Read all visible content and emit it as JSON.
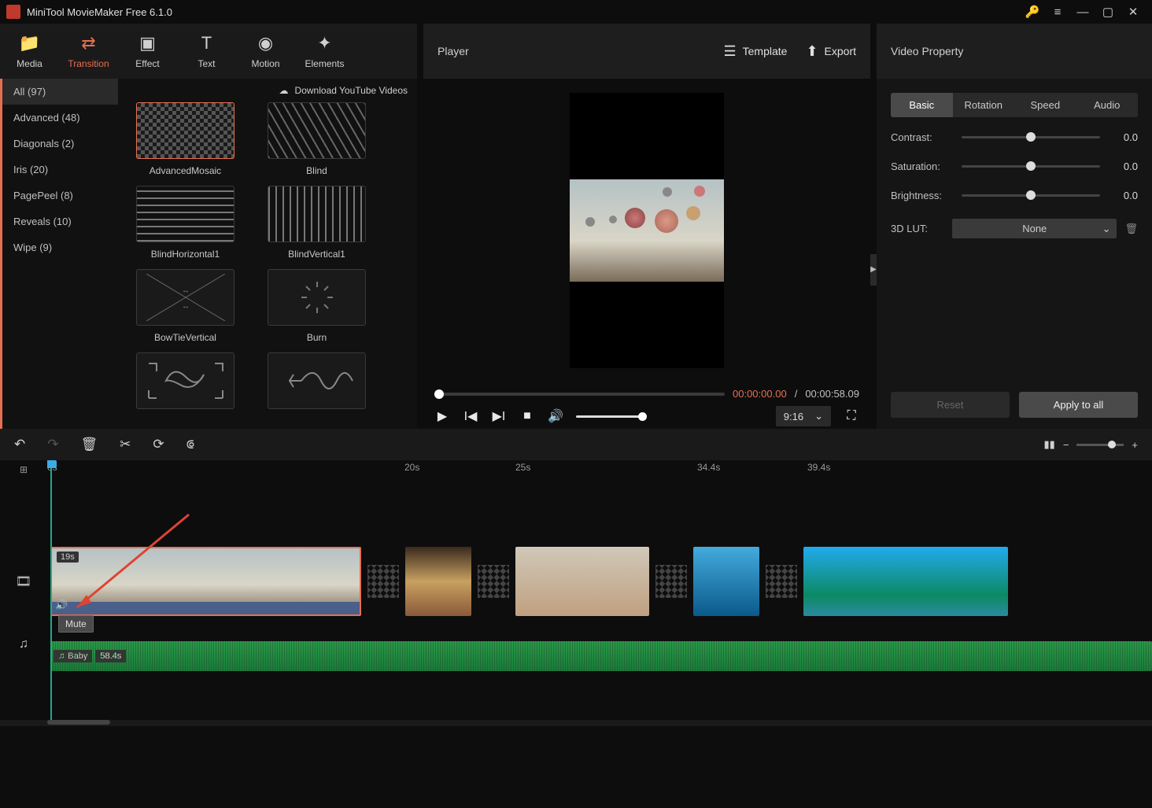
{
  "app": {
    "title": "MiniTool MovieMaker Free 6.1.0"
  },
  "tabs": {
    "media": "Media",
    "transition": "Transition",
    "effect": "Effect",
    "text": "Text",
    "motion": "Motion",
    "elements": "Elements"
  },
  "player_header": {
    "label": "Player",
    "template": "Template",
    "export": "Export"
  },
  "prop_header": {
    "label": "Video Property"
  },
  "library": {
    "download_link": "Download YouTube Videos",
    "categories": [
      {
        "label": "All (97)",
        "active": true
      },
      {
        "label": "Advanced (48)"
      },
      {
        "label": "Diagonals (2)"
      },
      {
        "label": "Iris (20)"
      },
      {
        "label": "PagePeel (8)"
      },
      {
        "label": "Reveals (10)"
      },
      {
        "label": "Wipe (9)"
      }
    ],
    "items": [
      {
        "label": "AdvancedMosaic",
        "style": "checker",
        "selected": true
      },
      {
        "label": "Blind",
        "style": "diag"
      },
      {
        "label": "BlindHorizontal1",
        "style": "hstripes"
      },
      {
        "label": "BlindVertical1",
        "style": "vstripes"
      },
      {
        "label": "BowTieVertical",
        "style": "svg-bowtie"
      },
      {
        "label": "Burn",
        "style": "svg-burn"
      },
      {
        "label": "",
        "style": "svg-cloud"
      },
      {
        "label": "",
        "style": "svg-wave"
      }
    ]
  },
  "player": {
    "current_time": "00:00:00.00",
    "duration": "00:00:58.09",
    "aspect": "9:16"
  },
  "props": {
    "tabs": {
      "basic": "Basic",
      "rotation": "Rotation",
      "speed": "Speed",
      "audio": "Audio"
    },
    "contrast": {
      "label": "Contrast:",
      "value": "0.0"
    },
    "saturation": {
      "label": "Saturation:",
      "value": "0.0"
    },
    "brightness": {
      "label": "Brightness:",
      "value": "0.0"
    },
    "lut": {
      "label": "3D LUT:",
      "value": "None"
    },
    "reset": "Reset",
    "apply": "Apply to all"
  },
  "timeline": {
    "ruler": [
      {
        "label": "0s",
        "pos": 0
      },
      {
        "label": "20s",
        "pos": 454
      },
      {
        "label": "25s",
        "pos": 595
      },
      {
        "label": "34.4s",
        "pos": 826
      },
      {
        "label": "39.4s",
        "pos": 966
      }
    ],
    "clip1_duration": "19s",
    "mute_tooltip": "Mute",
    "audio": {
      "name": "Baby",
      "duration": "58.4s"
    }
  }
}
